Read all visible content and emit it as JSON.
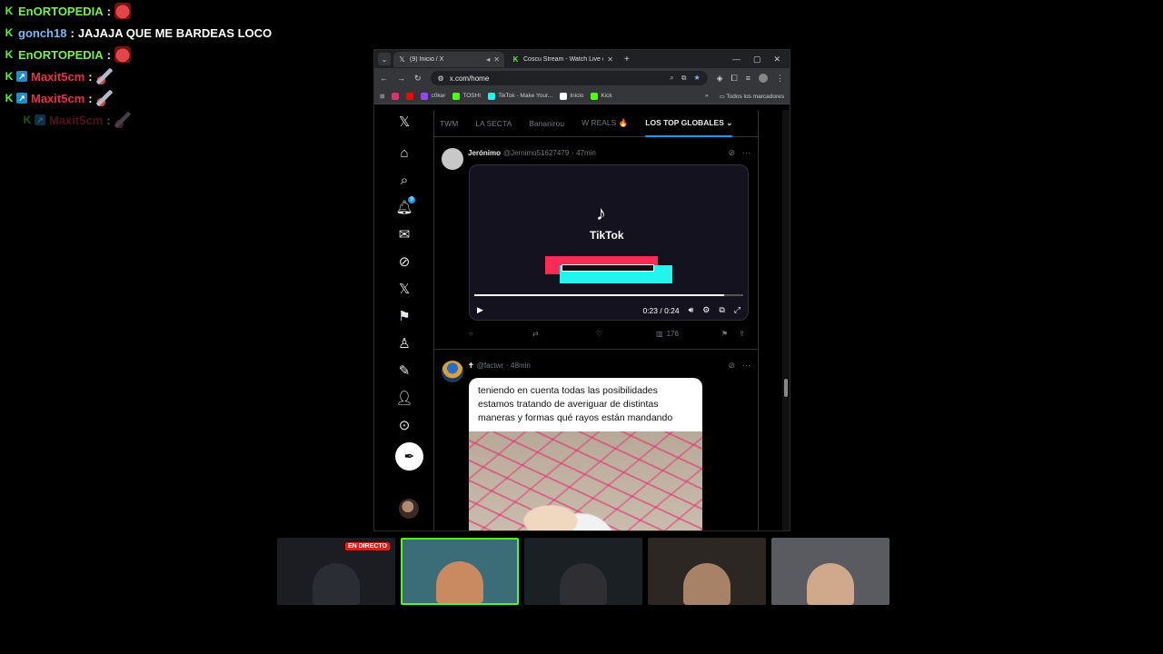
{
  "chat": [
    {
      "badges": [
        "kick"
      ],
      "user": "EnORTOPEDIA",
      "color": "#7bf04a",
      "message": "",
      "emote": "devil",
      "faded": false
    },
    {
      "badges": [
        "kick"
      ],
      "user": "gonch18",
      "color": "#7db8f5",
      "message": "JAJAJA QUE ME BARDEAS LOCO",
      "emote": "",
      "faded": false
    },
    {
      "badges": [
        "kick"
      ],
      "user": "EnORTOPEDIA",
      "color": "#7bf04a",
      "message": "",
      "emote": "devil",
      "faded": false
    },
    {
      "badges": [
        "kick",
        "prime"
      ],
      "user": "Maxit5cm",
      "color": "#e0324c",
      "message": "",
      "emote": "pen",
      "faded": false
    },
    {
      "badges": [
        "kick",
        "prime"
      ],
      "user": "Maxit5cm",
      "color": "#e0324c",
      "message": "",
      "emote": "pen",
      "faded": false
    },
    {
      "badges": [
        "kick",
        "prime"
      ],
      "user": "Maxit5cm",
      "color": "#e0324c",
      "message": "",
      "emote": "pen",
      "faded": true
    }
  ],
  "browser": {
    "tabs": [
      {
        "title": "(9) Inicio / X",
        "icon": "x-logo-icon",
        "active": true
      },
      {
        "title": "Coscu Stream - Watch Live on K",
        "icon": "kick-logo-icon",
        "active": false
      }
    ],
    "url": "x.com/home",
    "bookmarks": [
      {
        "label": "",
        "color": "#e1306c"
      },
      {
        "label": "",
        "color": "#ff0000"
      },
      {
        "label": "c0ker",
        "color": "#9146ff"
      },
      {
        "label": "TOSHI",
        "color": "#53fc18"
      },
      {
        "label": "TikTok - Make Your...",
        "color": "#25f4ee"
      },
      {
        "label": "Inicio",
        "color": "#ffffff"
      },
      {
        "label": "Kick",
        "color": "#53fc18"
      }
    ],
    "bookmarks_all": "Todos los marcadores"
  },
  "x": {
    "nav_badge": "9",
    "feed_tabs": [
      "TWM",
      "LA SECTA",
      "Bananirou",
      "W REALS 🔥",
      "LOS TOP GLOBALES ⌄"
    ],
    "tweets": [
      {
        "name": "Jerónimo",
        "handle": "@Jernimo51627479",
        "time": "· 47min",
        "video": {
          "logo": "♪",
          "brand": "TikTok",
          "time": "0:23 / 0:24",
          "progress": 0.93
        },
        "views": "176"
      },
      {
        "name": "",
        "handle": "@factwr",
        "time": "· 48min",
        "meme_text": "teniendo en cuenta todas las posibilidades estamos tratando de averiguar de distintas maneras y formas qué rayos están mandando"
      }
    ]
  },
  "cams": [
    {
      "live": "EN DIRECTO",
      "bg": "#1c1d22",
      "person": "#2b2d34",
      "active": false
    },
    {
      "live": "",
      "bg": "#3a6d78",
      "person": "#c98a62",
      "active": true
    },
    {
      "live": "",
      "bg": "#1b2024",
      "person": "#2f2f33",
      "active": false
    },
    {
      "live": "",
      "bg": "#2c2722",
      "person": "#a78266",
      "active": false
    },
    {
      "live": "",
      "bg": "#5a5b60",
      "person": "#d0a88c",
      "active": false
    }
  ]
}
